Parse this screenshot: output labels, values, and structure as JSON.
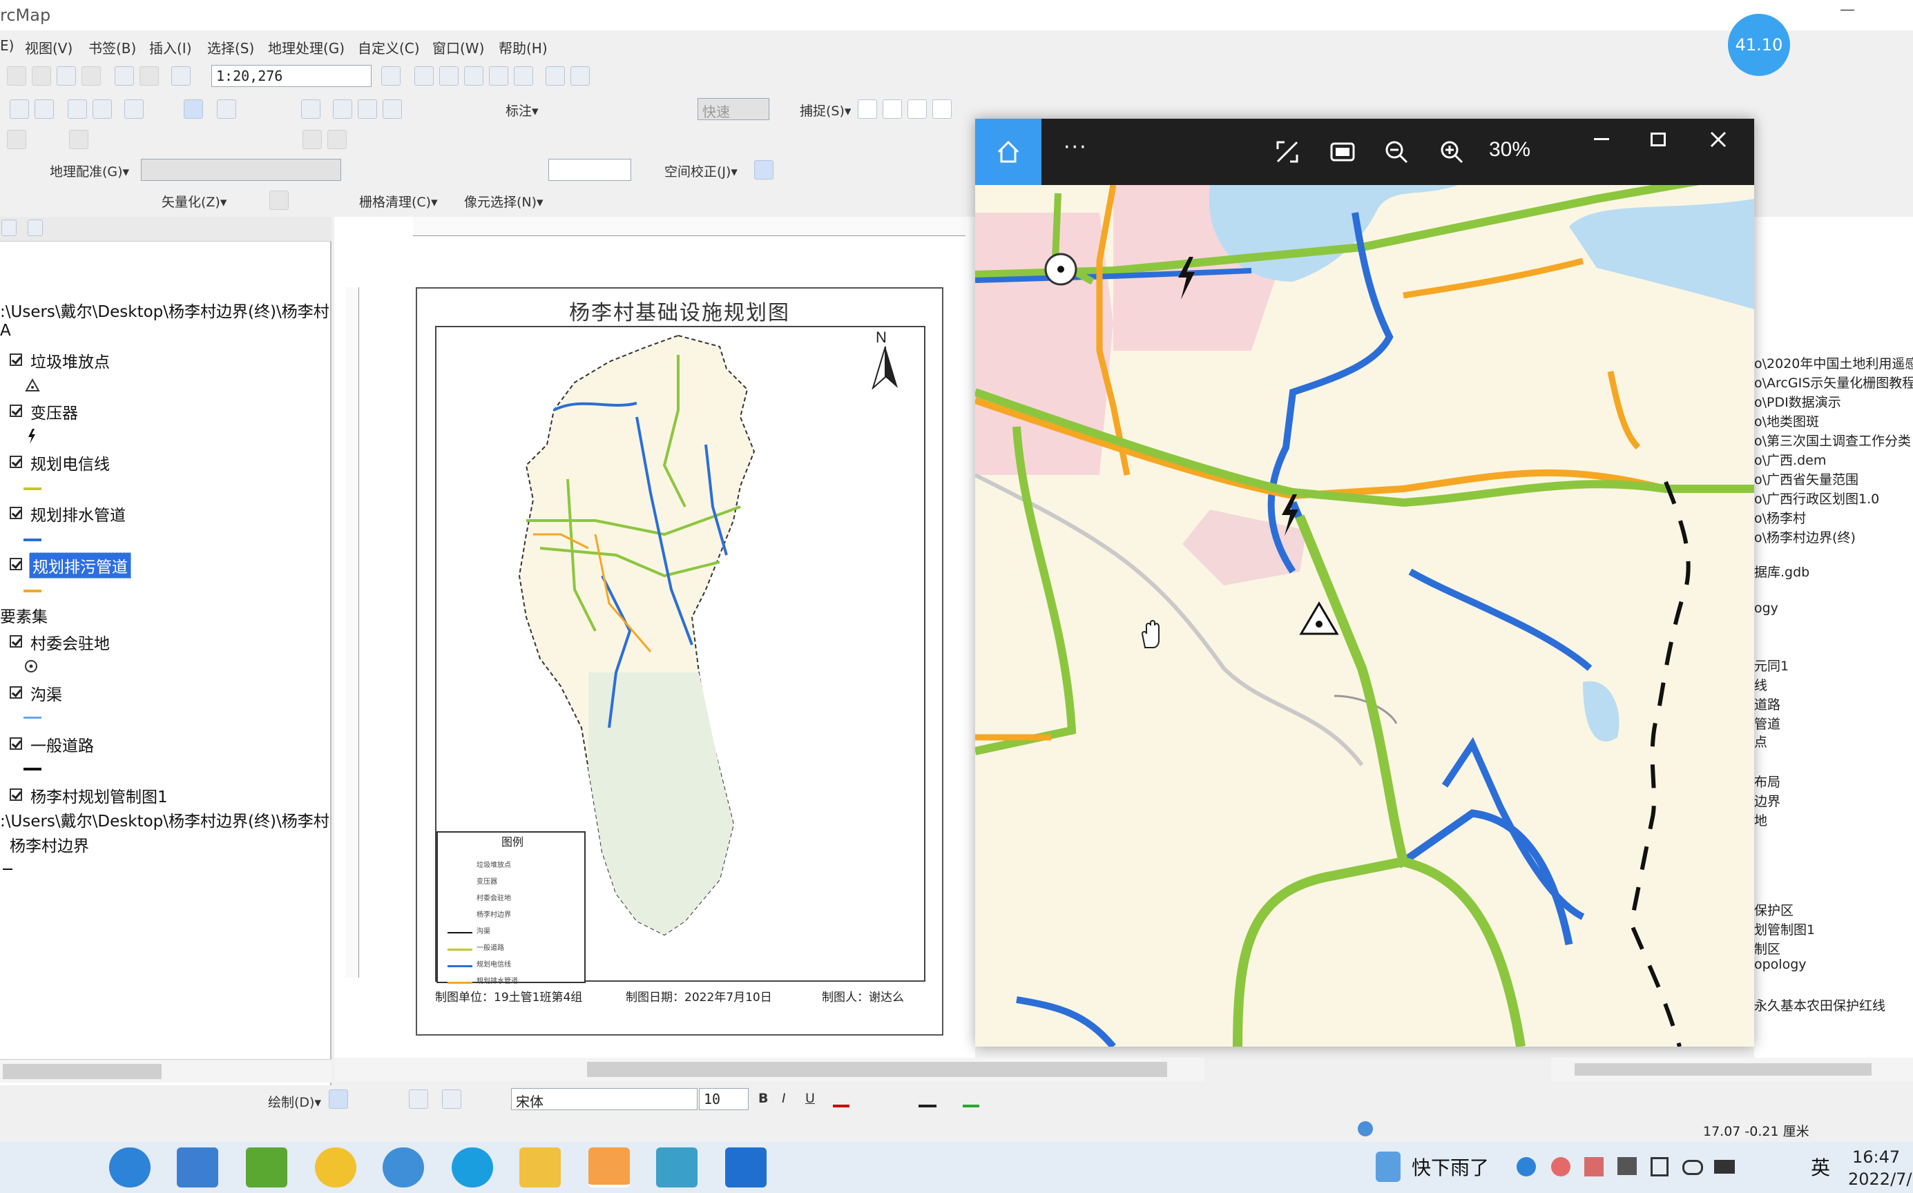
{
  "window": {
    "title": "rcMap",
    "badge": "41.10"
  },
  "menu": [
    "E)",
    "视图(V)",
    "书签(B)",
    "插入(I)",
    "选择(S)",
    "地理处理(G)",
    "自定义(C)",
    "窗口(W)",
    "帮助(H)"
  ],
  "toolbar": {
    "scale": "1:20,276",
    "label_tool": "标注▾",
    "quick_combo": "快速",
    "snap": "捕捉(S)▾",
    "georef": "地理配准(G)▾",
    "spatial_adjust": "空间校正(J)▾",
    "vectorize": "矢量化(Z)▾",
    "raster_clean": "栅格清理(C)▾",
    "cell_select": "像元选择(N)▾"
  },
  "toc": {
    "path1": ":\\Users\\戴尔\\Desktop\\杨李村边界(终)\\杨李村",
    "group_a": "A",
    "layers": [
      {
        "label": "垃圾堆放点",
        "symbol": "triangle-icon"
      },
      {
        "label": "变压器",
        "symbol": "bolt-icon"
      },
      {
        "label": "规划电信线",
        "symbol": "line-green"
      },
      {
        "label": "规划排水管道",
        "symbol": "line-blue"
      },
      {
        "label": "规划排污管道",
        "symbol": "line-orange",
        "selected": true
      }
    ],
    "group_features": "要素集",
    "layers2": [
      {
        "label": "村委会驻地",
        "symbol": "circle-dot-icon"
      },
      {
        "label": "沟渠",
        "symbol": "line-lightblue"
      },
      {
        "label": "一般道路",
        "symbol": "line-black"
      },
      {
        "label": "杨李村规划管制图1",
        "symbol": "none"
      }
    ],
    "path2": ":\\Users\\戴尔\\Desktop\\杨李村边界(终)\\杨李村",
    "boundary": "杨李村边界"
  },
  "layout": {
    "map_title": "杨李村基础设施规划图",
    "north": "N",
    "legend_title": "图例",
    "legend_items": [
      "垃圾堆放点",
      "变压器",
      "村委会驻地",
      "杨李村边界",
      "沟渠",
      "一般道路",
      "规划电信线",
      "规划排水管道",
      "规划排污管道"
    ],
    "footer_unit": "制图单位：19土管1班第4组",
    "footer_date": "制图日期：2022年7月10日",
    "footer_author": "制图人：谢达么"
  },
  "viewer": {
    "zoom": "30%",
    "more": "···"
  },
  "catalog": {
    "items": [
      "o\\2020年中国土地利用遥感",
      "o\\ArcGIS示矢量化栅图教程",
      "o\\PDI数据演示",
      "o\\地类图斑",
      "o\\第三次国土调查工作分类",
      "o\\广西.dem",
      "o\\广西省矢量范围",
      "o\\广西行政区划图1.0",
      "o\\杨李村",
      "o\\杨李村边界(终)",
      "据库.gdb",
      "ogy",
      "元同1",
      "线",
      "道路",
      "管道",
      "点",
      "布局",
      "边界",
      "地",
      "保护区",
      "划管制图1",
      "制区",
      "opology",
      "永久基本农田保护红线"
    ]
  },
  "drawbar": {
    "draw": "绘制(D)▾",
    "font": "宋体",
    "size": "10"
  },
  "status": {
    "coords": "17.07  -0.21 厘米"
  },
  "taskbar": {
    "weather": "快下雨了",
    "ime": "英",
    "time": "16:47",
    "date": "2022/7/"
  },
  "colors": {
    "green": "#8cc63f",
    "blue": "#2b6ed8",
    "orange": "#f5a623",
    "pink": "#f7d6da",
    "yellow": "#fbf1c9",
    "water": "#b9dcf2"
  }
}
